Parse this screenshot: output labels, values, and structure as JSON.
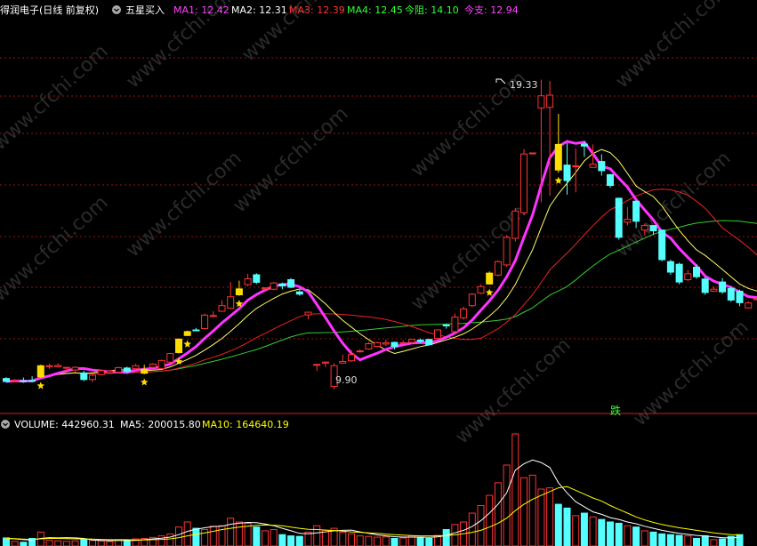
{
  "header": {
    "stock_label": "得润电子(日线 前复权)",
    "indicator_label": "五星买入",
    "ma": [
      {
        "text": "MA1: 12.42",
        "color": "#ff44ff"
      },
      {
        "text": "MA2: 12.31",
        "color": "#ffffff"
      },
      {
        "text": "MA3: 12.39",
        "color": "#ff3333"
      },
      {
        "text": "MA4: 12.45",
        "color": "#33ff33"
      },
      {
        "text": "今阻: 14.10",
        "color": "#33ff33"
      },
      {
        "text": "今支: 12.94",
        "color": "#ff44ff"
      }
    ]
  },
  "volume_header": [
    {
      "text": "VOLUME: 442960.31",
      "color": "#ffffff"
    },
    {
      "text": "MA5: 200015.80",
      "color": "#ffffff"
    },
    {
      "text": "MA10: 164640.19",
      "color": "#ffff00"
    }
  ],
  "annotations": {
    "high_label": "19.33",
    "low_label": "9.90",
    "fall_label": "跌"
  },
  "watermark": "www.cfchi.com",
  "colors": {
    "up": "#ff3333",
    "down": "#55ffff",
    "signal": "#ffdd00",
    "ma1": "#ff33ff",
    "ma2": "#ffff66",
    "ma3": "#ee2222",
    "ma4": "#33cc33",
    "grid": "#a01010",
    "divider": "#cc2222"
  },
  "chart_data": {
    "type": "candlestick",
    "title": "得润电子(日线 前复权)",
    "ylim": [
      9.3,
      21.0
    ],
    "candles": [
      [
        10.23,
        10.14,
        10.27,
        10.11
      ],
      [
        10.14,
        10.17,
        10.21,
        10.11
      ],
      [
        10.16,
        10.15,
        10.26,
        10.1
      ],
      [
        10.17,
        10.16,
        10.3,
        10.11
      ],
      [
        10.28,
        10.62,
        10.65,
        10.25
      ],
      [
        10.59,
        10.62,
        10.68,
        10.53
      ],
      [
        10.59,
        10.63,
        10.69,
        10.56
      ],
      [
        10.56,
        10.57,
        10.58,
        10.46
      ],
      [
        10.49,
        10.57,
        10.6,
        10.44
      ],
      [
        10.4,
        10.2,
        10.47,
        10.15
      ],
      [
        10.2,
        10.33,
        10.36,
        10.12
      ],
      [
        10.35,
        10.47,
        10.49,
        10.33
      ],
      [
        10.41,
        10.46,
        10.49,
        10.38
      ],
      [
        10.42,
        10.56,
        10.59,
        10.4
      ],
      [
        10.55,
        10.44,
        10.59,
        10.4
      ],
      [
        10.53,
        10.62,
        10.67,
        10.48
      ],
      [
        10.39,
        10.51,
        10.65,
        10.36
      ],
      [
        10.57,
        10.67,
        10.7,
        10.55
      ],
      [
        10.53,
        10.78,
        10.8,
        10.51
      ],
      [
        10.73,
        10.99,
        11.01,
        10.71
      ],
      [
        11.02,
        11.43,
        11.45,
        10.99
      ],
      [
        11.54,
        11.66,
        11.69,
        11.52
      ],
      [
        11.71,
        11.7,
        11.77,
        11.68
      ],
      [
        11.75,
        12.16,
        12.21,
        11.72
      ],
      [
        12.12,
        12.15,
        12.28,
        12.09
      ],
      [
        12.28,
        12.45,
        12.61,
        12.26
      ],
      [
        12.37,
        12.72,
        13.17,
        12.35
      ],
      [
        12.78,
        12.96,
        13.21,
        12.75
      ],
      [
        13.09,
        13.27,
        13.42,
        13.04
      ],
      [
        13.39,
        13.16,
        13.44,
        13.11
      ],
      [
        12.96,
        12.99,
        13.01,
        12.86
      ],
      [
        12.95,
        13.14,
        13.17,
        12.92
      ],
      [
        13.11,
        13.05,
        13.15,
        12.95
      ],
      [
        13.24,
        13.01,
        13.29,
        12.98
      ],
      [
        12.87,
        12.8,
        12.92,
        12.75
      ],
      [
        12.17,
        12.25,
        12.26,
        12.03
      ],
      [
        10.66,
        10.66,
        10.68,
        10.46
      ],
      [
        10.7,
        10.73,
        10.75,
        10.58
      ],
      [
        9.99,
        10.62,
        10.7,
        9.9
      ],
      [
        10.7,
        10.75,
        10.96,
        10.7
      ],
      [
        10.77,
        10.96,
        11.1,
        10.74
      ],
      [
        11.05,
        11.07,
        11.12,
        11.02
      ],
      [
        11.13,
        11.29,
        11.34,
        11.11
      ],
      [
        11.21,
        11.32,
        11.35,
        11.19
      ],
      [
        11.28,
        11.32,
        11.42,
        11.22
      ],
      [
        11.33,
        11.21,
        11.35,
        11.12
      ],
      [
        11.32,
        11.32,
        11.39,
        11.3
      ],
      [
        11.33,
        11.42,
        11.44,
        11.27
      ],
      [
        11.4,
        11.36,
        11.45,
        11.3
      ],
      [
        11.42,
        11.26,
        11.44,
        11.23
      ],
      [
        11.45,
        11.71,
        11.73,
        11.41
      ],
      [
        11.86,
        11.85,
        11.9,
        11.75
      ],
      [
        11.66,
        12.1,
        12.21,
        11.59
      ],
      [
        12.08,
        12.35,
        12.42,
        12.02
      ],
      [
        12.45,
        12.8,
        12.83,
        12.4
      ],
      [
        12.83,
        13.03,
        13.1,
        12.8
      ],
      [
        13.11,
        13.44,
        13.49,
        13.09
      ],
      [
        13.38,
        13.79,
        13.83,
        13.34
      ],
      [
        13.69,
        14.53,
        14.6,
        13.63
      ],
      [
        14.5,
        15.33,
        15.42,
        14.4
      ],
      [
        15.28,
        17.07,
        17.22,
        15.2
      ],
      [
        17.1,
        17.1,
        17.1,
        17.1
      ],
      [
        18.47,
        18.84,
        19.33,
        15.6
      ],
      [
        18.49,
        18.86,
        19.29,
        15.8
      ],
      [
        17.36,
        16.58,
        18.29,
        16.5
      ],
      [
        16.73,
        16.26,
        17.4,
        15.83
      ],
      [
        16.68,
        16.71,
        17.23,
        15.9
      ],
      [
        17.37,
        17.31,
        17.46,
        16.98
      ],
      [
        16.66,
        16.76,
        17.36,
        16.7
      ],
      [
        16.84,
        16.56,
        17.06,
        16.41
      ],
      [
        16.44,
        16.11,
        16.46,
        16.04
      ],
      [
        15.72,
        14.53,
        15.74,
        14.46
      ],
      [
        14.99,
        15.08,
        15.45,
        14.89
      ],
      [
        15.63,
        15.02,
        15.65,
        14.81
      ],
      [
        14.75,
        14.89,
        14.95,
        14.59
      ],
      [
        14.89,
        14.73,
        14.89,
        14.6
      ],
      [
        14.75,
        13.85,
        14.77,
        13.8
      ],
      [
        13.79,
        13.47,
        13.85,
        13.39
      ],
      [
        13.71,
        13.17,
        13.76,
        13.1
      ],
      [
        13.24,
        13.42,
        13.54,
        13.2
      ],
      [
        13.62,
        13.33,
        13.71,
        13.27
      ],
      [
        13.26,
        12.85,
        13.33,
        12.78
      ],
      [
        12.89,
        12.95,
        13.04,
        12.87
      ],
      [
        13.17,
        12.87,
        13.29,
        12.81
      ],
      [
        12.97,
        12.62,
        13.04,
        12.56
      ],
      [
        12.89,
        12.54,
        12.94,
        12.43
      ],
      [
        12.38,
        12.53,
        12.58,
        12.36
      ],
      [
        12.64,
        12.66,
        12.71,
        12.6
      ],
      [
        12.65,
        12.72,
        12.87,
        12.64
      ],
      [
        12.71,
        12.72,
        12.9,
        12.65
      ]
    ],
    "signal_days": [
      4,
      16,
      20,
      21,
      27,
      56,
      64
    ],
    "high": 19.33,
    "low": 9.9,
    "volume": {
      "ylim": [
        0,
        442960.31
      ],
      "values": [
        32000,
        18000,
        15000,
        30000,
        55000,
        22000,
        20000,
        18000,
        20000,
        25000,
        22000,
        20000,
        18000,
        22000,
        24000,
        28000,
        30000,
        34000,
        40000,
        48000,
        75000,
        95000,
        70000,
        65000,
        78000,
        80000,
        110000,
        95000,
        90000,
        75000,
        60000,
        65000,
        45000,
        40000,
        38000,
        55000,
        80000,
        62000,
        70000,
        55000,
        48000,
        40000,
        38000,
        35000,
        36000,
        30000,
        32000,
        40000,
        35000,
        30000,
        42000,
        65000,
        85000,
        95000,
        130000,
        160000,
        200000,
        250000,
        320000,
        442960,
        270000,
        280000,
        225000,
        230000,
        165000,
        150000,
        120000,
        130000,
        115000,
        105000,
        95000,
        90000,
        80000,
        75000,
        60000,
        55000,
        48000,
        45000,
        42000,
        40000,
        30000,
        40000,
        25000,
        28000,
        38000,
        45000
      ],
      "ma5": [
        30000,
        28000,
        25000,
        24000,
        30000,
        33000,
        32000,
        33000,
        32000,
        30000,
        24000,
        22000,
        21000,
        22000,
        22000,
        22000,
        25000,
        28000,
        31000,
        35000,
        45000,
        58000,
        66000,
        72000,
        77000,
        78000,
        86000,
        90000,
        93000,
        92000,
        87000,
        80000,
        70000,
        60000,
        50000,
        48000,
        52000,
        56000,
        60000,
        62000,
        63000,
        56000,
        50000,
        44000,
        40000,
        37000,
        35000,
        35000,
        35000,
        34000,
        36000,
        42000,
        52000,
        62000,
        77000,
        100000,
        130000,
        165000,
        210000,
        300000,
        325000,
        340000,
        330000,
        310000,
        250000,
        210000,
        175000,
        155000,
        135000,
        125000,
        112000,
        105000,
        95000,
        88000,
        78000,
        70000,
        62000,
        56000,
        50000,
        46000,
        42000,
        40000,
        36000,
        33000,
        32000,
        34000
      ],
      "ma10": [
        30000,
        29000,
        27000,
        26000,
        28000,
        30000,
        30000,
        29000,
        28000,
        28000,
        27000,
        26000,
        25000,
        25000,
        25000,
        24000,
        24000,
        25000,
        26000,
        28000,
        33000,
        40000,
        46000,
        52000,
        58000,
        65000,
        70000,
        75000,
        78000,
        82000,
        83000,
        82000,
        80000,
        75000,
        70000,
        66000,
        65000,
        63000,
        61000,
        59000,
        56000,
        54000,
        52000,
        50000,
        47000,
        45000,
        43000,
        41000,
        40000,
        40000,
        40000,
        41000,
        44000,
        48000,
        54000,
        62000,
        75000,
        90000,
        110000,
        140000,
        165000,
        185000,
        200000,
        215000,
        230000,
        235000,
        220000,
        205000,
        190000,
        178000,
        160000,
        145000,
        130000,
        115000,
        103000,
        93000,
        85000,
        78000,
        72000,
        67000,
        62000,
        57000,
        52000,
        48000,
        45000,
        44000
      ]
    }
  }
}
